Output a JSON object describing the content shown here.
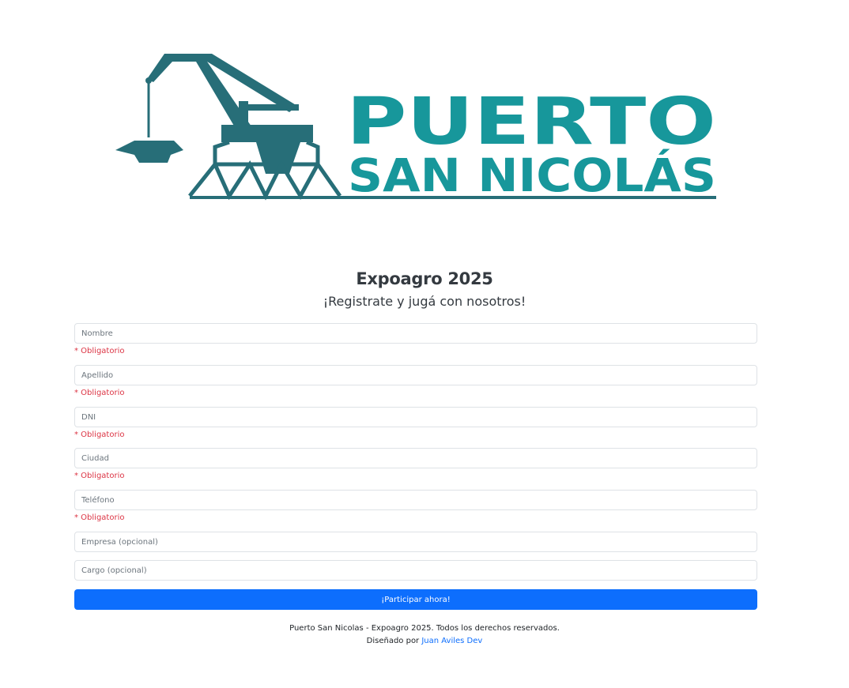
{
  "logo": {
    "line1": "PUERTO",
    "line2": "SAN NICOLÁS",
    "crane_color": "#276e78",
    "text_color": "#17979b"
  },
  "header": {
    "title": "Expoagro 2025",
    "subtitle": "¡Registrate y jugá con nosotros!"
  },
  "form": {
    "required_label": "* Obligatorio",
    "fields": [
      {
        "placeholder": "Nombre",
        "value": "",
        "required": true
      },
      {
        "placeholder": "Apellido",
        "value": "",
        "required": true
      },
      {
        "placeholder": "DNI",
        "value": "",
        "required": true
      },
      {
        "placeholder": "Ciudad",
        "value": "",
        "required": true
      },
      {
        "placeholder": "Teléfono",
        "value": "",
        "required": true
      },
      {
        "placeholder": "Empresa (opcional)",
        "value": "",
        "required": false
      },
      {
        "placeholder": "Cargo (opcional)",
        "value": "",
        "required": false
      }
    ],
    "submit_label": "¡Participar ahora!"
  },
  "footer": {
    "copyright": "Puerto San Nicolas - Expoagro 2025. Todos los derechos reservados.",
    "designed_by_prefix": "Diseñado por",
    "designer_link": "Juan Aviles Dev"
  },
  "colors": {
    "primary": "#0d6efd",
    "danger": "#dc3545",
    "border": "#dee2e6"
  }
}
